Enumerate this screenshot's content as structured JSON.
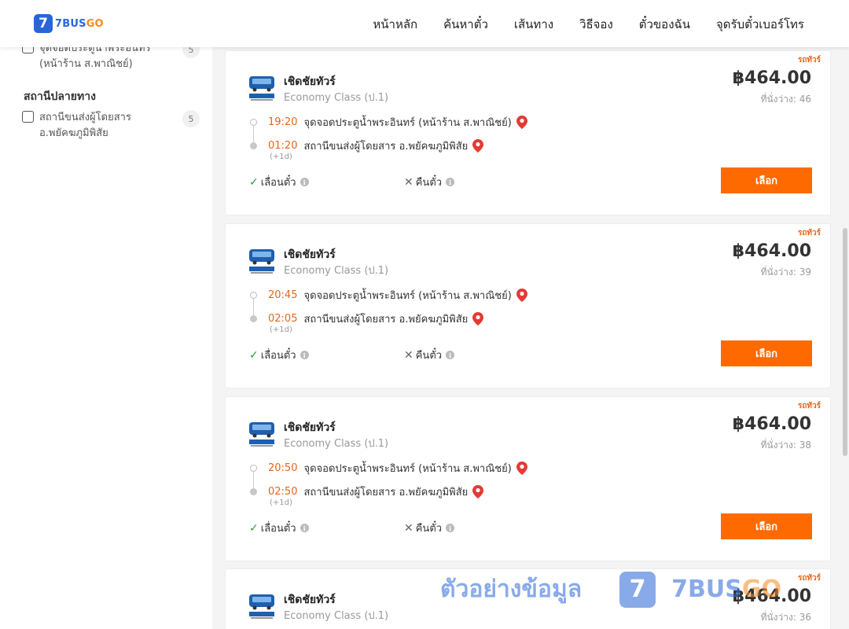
{
  "header": {
    "logo_mark": "7",
    "logo_text_main": "7BUS",
    "logo_text_go": "GO",
    "nav": [
      "หน้าหลัก",
      "ค้นหาตั๋ว",
      "เส้นทาง",
      "วิธีจอง",
      "ตั๋วของฉัน",
      "จุดรับตั๋วเบอร์โทร"
    ]
  },
  "sidebar": {
    "filter_top": {
      "label": "จุดจอดประตูน้ำพระอินทร์ (หน้าร้าน ส.พาณิชย์)",
      "count": "5"
    },
    "dest_title": "สถานีปลายทาง",
    "filter_dest": {
      "label": "สถานีขนส่งผู้โดยสาร อ.พยัคฆภูมิพิสัย",
      "count": "5"
    }
  },
  "trips": [
    {
      "tag": "รถทัวร์",
      "operator": "เชิดชัยทัวร์",
      "class": "Economy Class (ป.1)",
      "price": "฿464.00",
      "seats": "ที่นั่งว่าง: 46",
      "depart_time": "19:20",
      "depart_place": "จุดจอดประตูน้ำพระอินทร์ (หน้าร้าน ส.พาณิชย์)",
      "arrive_time": "01:20",
      "arrive_place": "สถานีขนส่งผู้โดยสาร อ.พยัคฆภูมิพิสัย",
      "next_day": "(+1d)",
      "change": "เลื่อนตั๋ว",
      "refund": "คืนตั๋ว",
      "select": "เลือก"
    },
    {
      "tag": "รถทัวร์",
      "operator": "เชิดชัยทัวร์",
      "class": "Economy Class (ป.1)",
      "price": "฿464.00",
      "seats": "ที่นั่งว่าง: 39",
      "depart_time": "20:45",
      "depart_place": "จุดจอดประตูน้ำพระอินทร์ (หน้าร้าน ส.พาณิชย์)",
      "arrive_time": "02:05",
      "arrive_place": "สถานีขนส่งผู้โดยสาร อ.พยัคฆภูมิพิสัย",
      "next_day": "(+1d)",
      "change": "เลื่อนตั๋ว",
      "refund": "คืนตั๋ว",
      "select": "เลือก"
    },
    {
      "tag": "รถทัวร์",
      "operator": "เชิดชัยทัวร์",
      "class": "Economy Class (ป.1)",
      "price": "฿464.00",
      "seats": "ที่นั่งว่าง: 38",
      "depart_time": "20:50",
      "depart_place": "จุดจอดประตูน้ำพระอินทร์ (หน้าร้าน ส.พาณิชย์)",
      "arrive_time": "02:50",
      "arrive_place": "สถานีขนส่งผู้โดยสาร อ.พยัคฆภูมิพิสัย",
      "next_day": "(+1d)",
      "change": "เลื่อนตั๋ว",
      "refund": "คืนตั๋ว",
      "select": "เลือก"
    },
    {
      "tag": "รถทัวร์",
      "operator": "เชิดชัยทัวร์",
      "class": "Economy Class (ป.1)",
      "price": "฿464.00",
      "seats": "ที่นั่งว่าง: 36"
    }
  ],
  "watermark": {
    "text": "ตัวอย่างข้อมูล",
    "mark": "7",
    "brand_main": "7BUS",
    "brand_go": "GO"
  },
  "colors": {
    "brand_blue": "#2866d8",
    "brand_orange": "#f48a1c",
    "accent_orange": "#ff6a00",
    "time_orange": "#e5661c",
    "pin_red": "#e53935"
  }
}
